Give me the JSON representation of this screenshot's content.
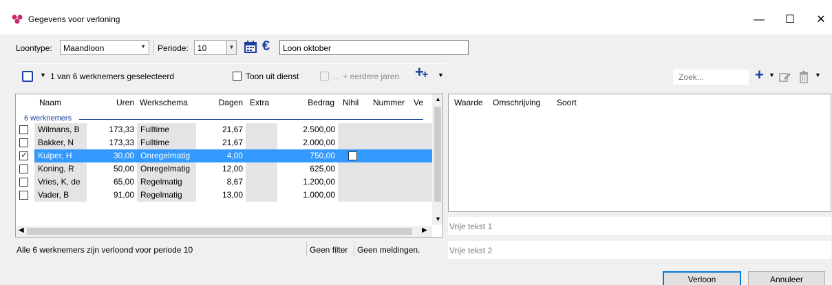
{
  "window": {
    "title": "Gegevens voor verloning",
    "minimize_glyph": "—",
    "maximize_glyph": "☐",
    "close_glyph": "✕"
  },
  "toolbar": {
    "loontype_label": "Loontype:",
    "loontype_value": "Maandloon",
    "periode_label": "Periode:",
    "periode_value": "10",
    "calendar_icon": "calendar-icon",
    "euro_glyph": "€",
    "description_value": "Loon oktober"
  },
  "left_panel": {
    "selection_text": "1 van 6 werknemers geselecteerd",
    "toon_uit_dienst_label": "Toon uit dienst",
    "meerdere_jaren_label": "… + eerdere jaren",
    "group_label": "6 werknemers",
    "columns": [
      "Naam",
      "Uren",
      "Werkschema",
      "Dagen",
      "Extra",
      "Bedrag",
      "Nihil",
      "Nummer",
      "Ve"
    ],
    "rows": [
      {
        "checked": false,
        "naam": "Wilmans, B",
        "uren": "173,33",
        "werkschema": "Fulltime",
        "dagen": "21,67",
        "extra": "",
        "bedrag": "2.500,00",
        "selected": false
      },
      {
        "checked": false,
        "naam": "Bakker, N",
        "uren": "173,33",
        "werkschema": "Fulltime",
        "dagen": "21,67",
        "extra": "",
        "bedrag": "2.000,00",
        "selected": false
      },
      {
        "checked": true,
        "naam": "Kuiper, H",
        "uren": "30,00",
        "werkschema": "Onregelmatig",
        "dagen": "4,00",
        "extra": "",
        "bedrag": "750,00",
        "selected": true
      },
      {
        "checked": false,
        "naam": "Koning, R",
        "uren": "50,00",
        "werkschema": "Onregelmatig",
        "dagen": "12,00",
        "extra": "",
        "bedrag": "625,00",
        "selected": false
      },
      {
        "checked": false,
        "naam": "Vries, K, de",
        "uren": "65,00",
        "werkschema": "Regelmatig",
        "dagen": "8,67",
        "extra": "",
        "bedrag": "1.200,00",
        "selected": false
      },
      {
        "checked": false,
        "naam": "Vader, B",
        "uren": "91,00",
        "werkschema": "Regelmatig",
        "dagen": "13,00",
        "extra": "",
        "bedrag": "1.000,00",
        "selected": false
      }
    ],
    "status_text": "Alle 6 werknemers zijn verloond voor periode 10",
    "filter_text": "Geen filter",
    "messages_text": "Geen meldingen."
  },
  "right_panel": {
    "search_placeholder": "Zoek...",
    "columns": [
      "Waarde",
      "Omschrijving",
      "Soort"
    ],
    "vrije_tekst_1": "Vrije tekst 1",
    "vrije_tekst_2": "Vrije tekst 2"
  },
  "footer": {
    "verloon_label": "Verloon",
    "annuleer_label": "Annuleer"
  },
  "colors": {
    "selection": "#3399ff",
    "accent_blue": "#1a3fa0",
    "app_icon": "#c8286e"
  }
}
